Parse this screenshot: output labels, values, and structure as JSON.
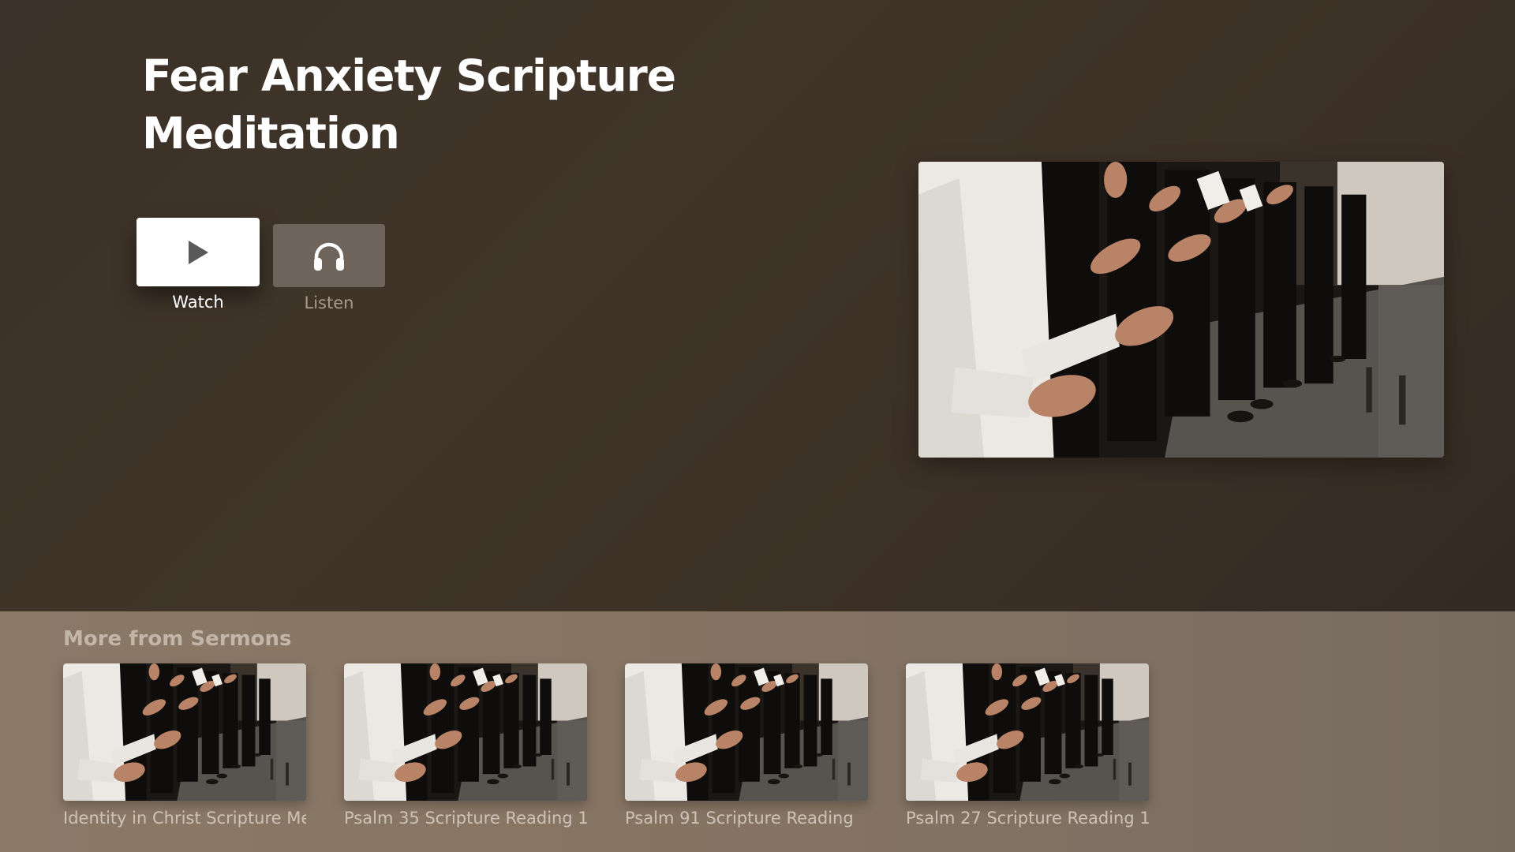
{
  "main": {
    "title": "Fear Anxiety Scripture Meditation",
    "actions": [
      {
        "label": "Watch",
        "icon": "play-icon",
        "focused": true
      },
      {
        "label": "Listen",
        "icon": "headphones-icon",
        "focused": false
      }
    ],
    "artwork": "worship-hands-image"
  },
  "shelf": {
    "title": "More from Sermons",
    "items": [
      {
        "label": "Identity in Christ Scripture Meditation",
        "image": "worship-hands-image"
      },
      {
        "label": "Psalm 35 Scripture Reading 1",
        "image": "worship-hands-image"
      },
      {
        "label": "Psalm 91 Scripture Reading",
        "image": "worship-hands-image"
      },
      {
        "label": "Psalm 27 Scripture Reading 1",
        "image": "worship-hands-image"
      }
    ]
  },
  "colors": {
    "background": "#3b3128",
    "shelf": "#877563",
    "focused_button": "#ffffff",
    "unfocused_button": "#6e645b"
  }
}
